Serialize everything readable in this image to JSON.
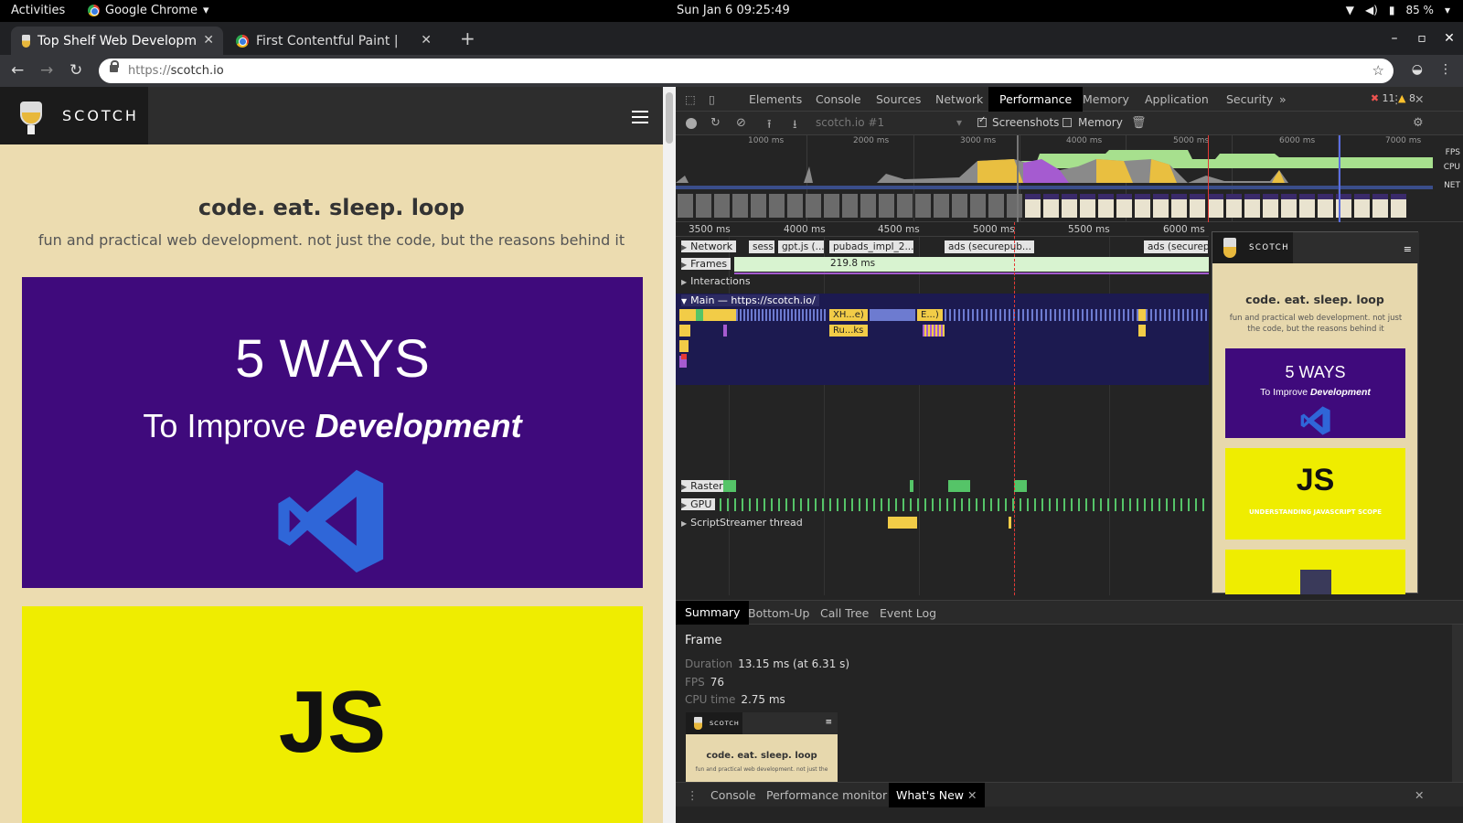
{
  "system": {
    "activities": "Activities",
    "app_name": "Google Chrome",
    "clock": "Sun Jan 6  09:25:49",
    "battery": "85 %"
  },
  "browser": {
    "tabs": [
      {
        "label": "Top Shelf Web Developm",
        "active": true
      },
      {
        "label": "First  Contentful  Paint   |",
        "active": false
      }
    ],
    "url_scheme": "https://",
    "url_host": "scotch.io"
  },
  "site": {
    "logo_text": "SCOTCH",
    "title": "code. eat. sleep. loop",
    "subtitle": "fun and practical web development. not just the code, but the reasons behind it",
    "card1_big": "5 WAYS",
    "card1_sub_prefix": "To Improve ",
    "card1_sub_bold": "Development",
    "card2_text": "JS"
  },
  "devtools": {
    "tabs": [
      "Elements",
      "Console",
      "Sources",
      "Network",
      "Performance",
      "Memory",
      "Application",
      "Security"
    ],
    "active_tab": "Performance",
    "more": "»",
    "errors": "11",
    "warnings": "8",
    "profile": "scotch.io #1",
    "screenshots_label": "Screenshots",
    "memory_label": "Memory",
    "overview_ticks": [
      "1000 ms",
      "2000 ms",
      "3000 ms",
      "4000 ms",
      "5000 ms",
      "6000 ms",
      "7000 ms"
    ],
    "lane_labels": {
      "fps": "FPS",
      "cpu": "CPU",
      "net": "NET"
    },
    "ruler_ticks": [
      "3500 ms",
      "4000 ms",
      "4500 ms",
      "5000 ms",
      "5500 ms",
      "6000 ms",
      "6500 ms",
      "7000 ms"
    ],
    "tracks": {
      "network": "Network",
      "frames": "Frames",
      "frames_value": "219.8 ms",
      "interactions": "Interactions",
      "main": "Main — https://scotch.io/",
      "raster": "Raster",
      "gpu": "GPU",
      "scriptstreamer": "ScriptStreamer thread"
    },
    "network_requests": [
      "sess",
      "gpt.js (...",
      "pubads_impl_2...",
      "ads (securepub...",
      "ads (securep..."
    ],
    "main_blocks": [
      "XH...e)",
      "E...)",
      "Ru...ks"
    ],
    "preview": {
      "logo_text": "SCOTCH",
      "title": "code. eat. sleep. loop",
      "subtitle": "fun and practical web development. not just the code, but the reasons behind it",
      "card1_big": "5 WAYS",
      "card1_sub_prefix": "To Improve ",
      "card1_sub_bold": "Development",
      "card2_text": "JS",
      "card2_small": "UNDERSTANDING JAVASCRIPT SCOPE"
    },
    "bottom_tabs": [
      "Summary",
      "Bottom-Up",
      "Call Tree",
      "Event Log"
    ],
    "summary": {
      "heading": "Frame",
      "duration_label": "Duration",
      "duration_value": "13.15 ms (at 6.31 s)",
      "fps_label": "FPS",
      "fps_value": "76",
      "cpu_label": "CPU time",
      "cpu_value": "2.75 ms",
      "thumb_logo": "SCOTCH",
      "thumb_title": "code. eat. sleep. loop",
      "thumb_sub": "fun and practical web development. not just the"
    },
    "drawer_tabs": [
      "Console",
      "Performance monitor",
      "What's New"
    ]
  }
}
